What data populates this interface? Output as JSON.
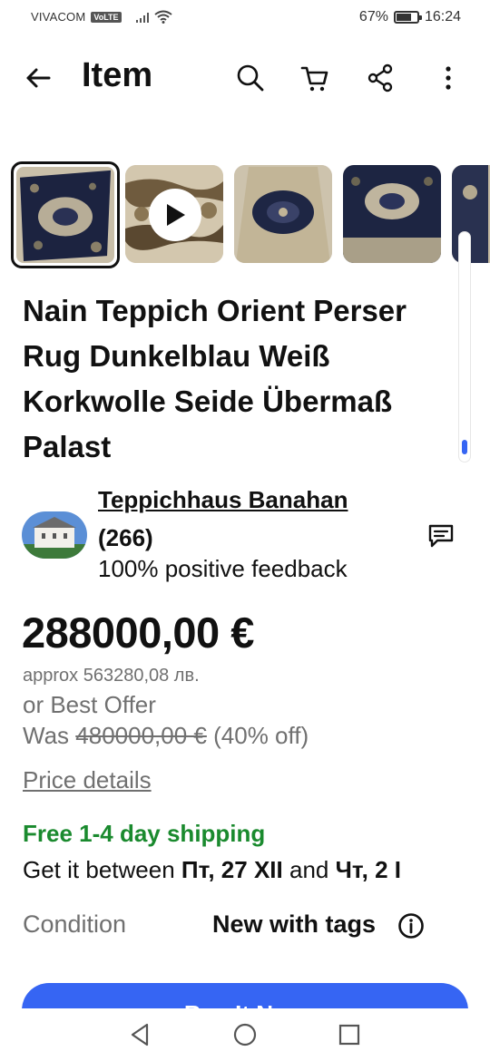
{
  "status_bar": {
    "carrier": "VIVACOM",
    "volte": "VoLTE",
    "battery": "67%",
    "battery_level": 0.67,
    "time": "16:24"
  },
  "header": {
    "title": "Item",
    "icons": [
      "back-arrow-icon",
      "search-icon",
      "cart-icon",
      "share-icon",
      "more-vertical-icon"
    ]
  },
  "gallery": {
    "thumbnails": [
      "rug-photo",
      "rug-video",
      "rug-photo",
      "rug-photo",
      "rug-photo"
    ],
    "selected_index": 0
  },
  "product": {
    "title": "Nain Teppich Orient Perser Rug Dunkelblau Weiß Korkwolle Seide Übermaß Palast"
  },
  "seller": {
    "name": "Teppichhaus Banahan",
    "count": "(266)",
    "feedback": "100% positive feedback"
  },
  "price": {
    "current": "288000,00 €",
    "approx": "approx 563280,08 лв.",
    "best_offer": "or Best Offer",
    "was_label": "Was",
    "was_price": "480000,00 €",
    "discount": "(40% off)",
    "details_link": "Price details"
  },
  "shipping": {
    "free": "Free 1-4 day shipping",
    "get_it_prefix": "Get it between",
    "start": "Пт, 27 XII",
    "and": "and",
    "end": "Чт, 2 I"
  },
  "condition": {
    "label": "Condition",
    "value": "New with tags"
  },
  "buy": {
    "label": "Buy It Now"
  },
  "colors": {
    "accent_blue": "#3665f3",
    "shipping_green": "#1a8a2e",
    "muted_gray": "#707070",
    "text": "#111111"
  }
}
